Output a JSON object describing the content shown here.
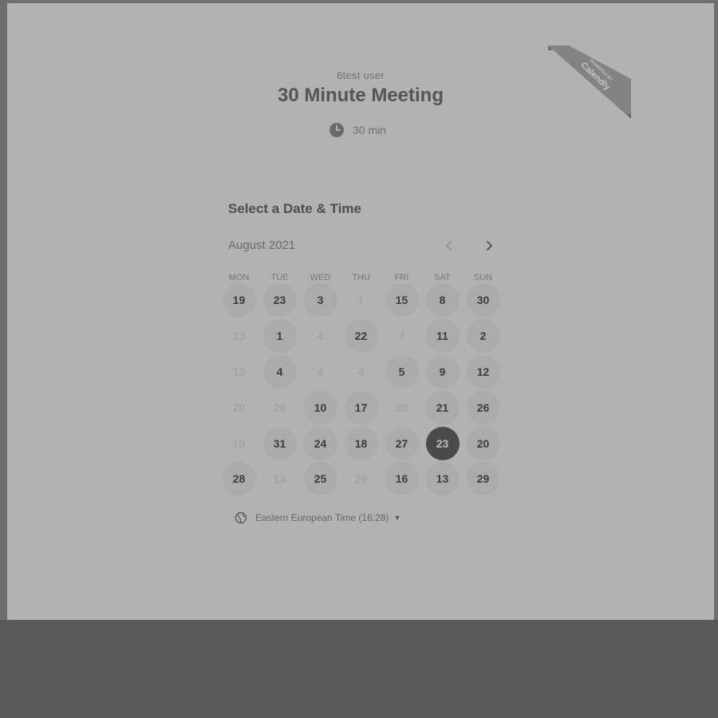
{
  "header": {
    "host_name": "6test user",
    "event_title": "30 Minute Meeting",
    "duration_label": "30 min",
    "duration_icon": "clock-icon"
  },
  "badge": {
    "line1": "POWERED BY",
    "line2": "Calendly"
  },
  "scheduler": {
    "section_title": "Select a Date & Time",
    "month_label": "August 2021",
    "prev_icon": "chevron-left-icon",
    "next_icon": "chevron-right-icon",
    "weekdays": [
      "MON",
      "TUE",
      "WED",
      "THU",
      "FRI",
      "SAT",
      "SUN"
    ],
    "days": [
      {
        "label": "19",
        "state": "available"
      },
      {
        "label": "23",
        "state": "available"
      },
      {
        "label": "3",
        "state": "available"
      },
      {
        "label": "1",
        "state": "unavailable"
      },
      {
        "label": "15",
        "state": "available"
      },
      {
        "label": "8",
        "state": "available"
      },
      {
        "label": "30",
        "state": "available"
      },
      {
        "label": "13",
        "state": "unavailable"
      },
      {
        "label": "1",
        "state": "available"
      },
      {
        "label": "4",
        "state": "unavailable"
      },
      {
        "label": "22",
        "state": "available"
      },
      {
        "label": "7",
        "state": "unavailable"
      },
      {
        "label": "11",
        "state": "available"
      },
      {
        "label": "2",
        "state": "available"
      },
      {
        "label": "13",
        "state": "unavailable"
      },
      {
        "label": "4",
        "state": "available"
      },
      {
        "label": "4",
        "state": "unavailable"
      },
      {
        "label": "4",
        "state": "unavailable"
      },
      {
        "label": "5",
        "state": "available"
      },
      {
        "label": "9",
        "state": "available"
      },
      {
        "label": "12",
        "state": "available"
      },
      {
        "label": "20",
        "state": "unavailable"
      },
      {
        "label": "26",
        "state": "unavailable"
      },
      {
        "label": "10",
        "state": "available"
      },
      {
        "label": "17",
        "state": "available"
      },
      {
        "label": "30",
        "state": "unavailable"
      },
      {
        "label": "21",
        "state": "available"
      },
      {
        "label": "26",
        "state": "available"
      },
      {
        "label": "10",
        "state": "unavailable"
      },
      {
        "label": "31",
        "state": "available"
      },
      {
        "label": "24",
        "state": "available"
      },
      {
        "label": "18",
        "state": "available"
      },
      {
        "label": "27",
        "state": "available"
      },
      {
        "label": "23",
        "state": "selected"
      },
      {
        "label": "20",
        "state": "available"
      },
      {
        "label": "28",
        "state": "available"
      },
      {
        "label": "13",
        "state": "unavailable"
      },
      {
        "label": "25",
        "state": "available"
      },
      {
        "label": "29",
        "state": "unavailable"
      },
      {
        "label": "16",
        "state": "available"
      },
      {
        "label": "13",
        "state": "available"
      },
      {
        "label": "29",
        "state": "available"
      }
    ]
  },
  "timezone": {
    "icon": "globe-icon",
    "label": "Eastern European Time (16:28)"
  },
  "colors": {
    "page_background": "#5a5a5a",
    "card_background": "#b2b2b2",
    "selected_day": "#4a4a4a",
    "available_day": "#ababab"
  }
}
